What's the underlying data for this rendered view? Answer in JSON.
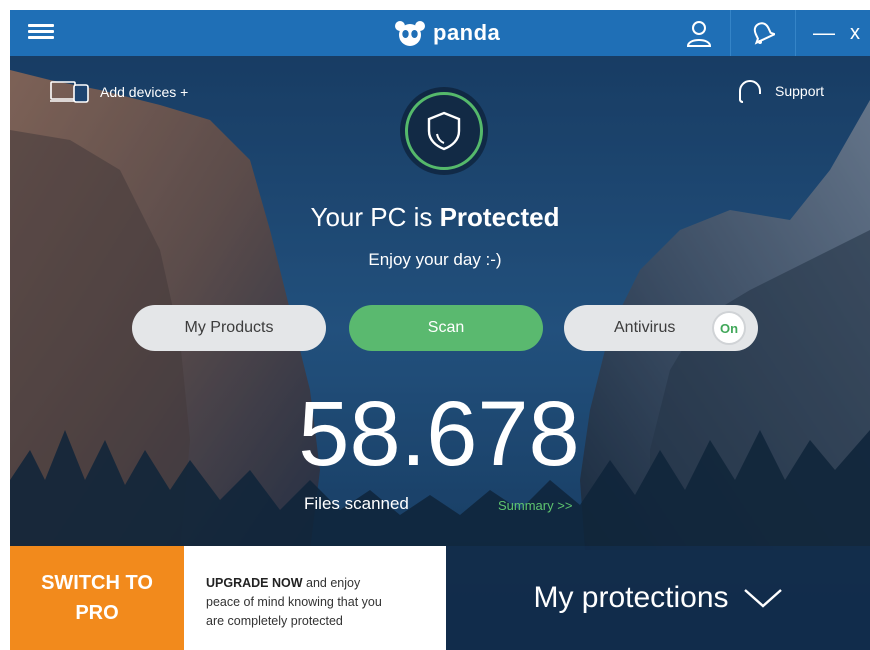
{
  "titlebar": {
    "logo_text": "panda",
    "minimize_glyph": "—",
    "close_glyph": "x"
  },
  "header_links": {
    "add_devices": "Add devices +",
    "support": "Support"
  },
  "status": {
    "prefix": "Your PC is ",
    "state": "Protected",
    "message": "Enjoy your day :-)"
  },
  "actions": {
    "my_products": "My Products",
    "scan": "Scan",
    "antivirus": "Antivirus",
    "antivirus_toggle": "On"
  },
  "scan_stats": {
    "files_count": "58.678",
    "files_label": "Files scanned",
    "summary_link": "Summary >>"
  },
  "bottom": {
    "switch_line1": "SWITCH TO",
    "switch_line2": "PRO",
    "upgrade_bold": "UPGRADE NOW",
    "upgrade_line1_rest": " and enjoy",
    "upgrade_line2": "peace of mind knowing that you",
    "upgrade_line3": "are completely protected",
    "my_protections": "My protections"
  },
  "colors": {
    "titlebar": "#1f6fb6",
    "accent_green": "#5ab96f",
    "accent_orange": "#f28a1c",
    "pill_grey": "#e4e6e8"
  },
  "icons": [
    "menu-icon",
    "panda-logo-icon",
    "user-icon",
    "bell-icon",
    "devices-icon",
    "headset-icon",
    "shield-icon",
    "chevron-down-icon"
  ]
}
